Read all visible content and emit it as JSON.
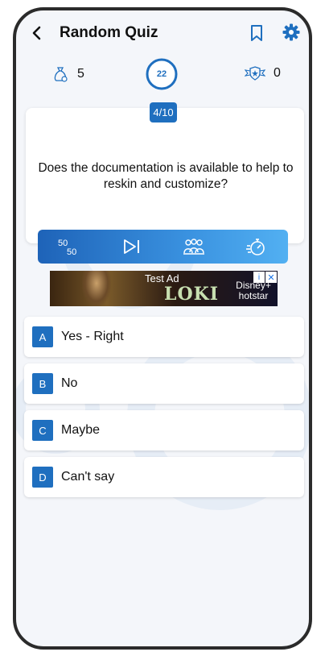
{
  "header": {
    "title": "Random Quiz",
    "back_icon": "back-arrow-icon",
    "bookmark_icon": "bookmark-icon",
    "settings_icon": "gear-icon"
  },
  "stats": {
    "coins": "5",
    "timer": "22",
    "score": "0"
  },
  "question": {
    "progress": "4/10",
    "text": "Does the documentation is available to help to reskin and customize?"
  },
  "lifelines": [
    {
      "name": "fifty-fifty",
      "label": "50/50"
    },
    {
      "name": "skip",
      "label": "skip"
    },
    {
      "name": "audience-poll",
      "label": "audience poll"
    },
    {
      "name": "reset-timer",
      "label": "timer"
    }
  ],
  "ad": {
    "label": "Test Ad",
    "brand": "LOKI",
    "partner": "Disney+ hotstar",
    "close": "✕",
    "info": "i"
  },
  "options": [
    {
      "letter": "A",
      "text": "Yes - Right"
    },
    {
      "letter": "B",
      "text": "No"
    },
    {
      "letter": "C",
      "text": "Maybe"
    },
    {
      "letter": "D",
      "text": "Can't say"
    }
  ],
  "colors": {
    "primary": "#1f6fbf",
    "background": "#f4f6fa",
    "frame": "#2b2b2b"
  }
}
